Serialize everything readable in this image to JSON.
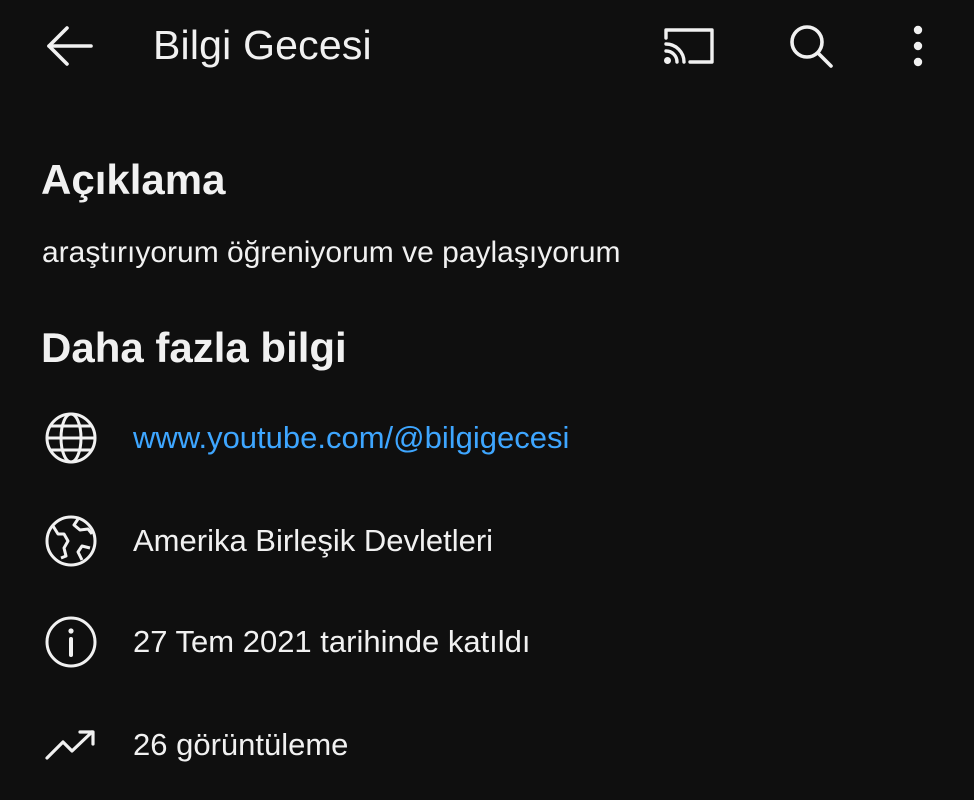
{
  "header": {
    "title": "Bilgi Gecesi",
    "back_icon": "arrow-left-icon",
    "cast_icon": "cast-icon",
    "search_icon": "search-icon",
    "more_icon": "more-vertical-icon"
  },
  "description_section": {
    "heading": "Açıklama",
    "text": "araştırıyorum öğreniyorum ve paylaşıyorum"
  },
  "more_info_section": {
    "heading": "Daha fazla bilgi",
    "items": [
      {
        "icon": "globe-icon",
        "text": "www.youtube.com/@bilgigecesi",
        "is_link": true
      },
      {
        "icon": "earth-map-icon",
        "text": "Amerika Birleşik Devletleri",
        "is_link": false
      },
      {
        "icon": "info-icon",
        "text": "27 Tem 2021 tarihinde katıldı",
        "is_link": false
      },
      {
        "icon": "trending-up-icon",
        "text": "26 görüntüleme",
        "is_link": false
      }
    ]
  },
  "colors": {
    "background": "#0f0f0f",
    "text": "#f1f1f1",
    "link": "#3ea6ff"
  }
}
